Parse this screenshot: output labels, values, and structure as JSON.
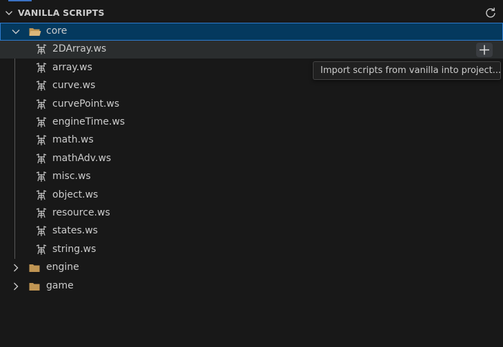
{
  "section": {
    "title": "VANILLA SCRIPTS",
    "collapse_icon": "chevron-down-icon",
    "refresh_icon": "refresh-icon"
  },
  "tree": {
    "core": {
      "label": "core",
      "expanded": true,
      "files": [
        {
          "label": "2DArray.ws"
        },
        {
          "label": "array.ws"
        },
        {
          "label": "curve.ws"
        },
        {
          "label": "curvePoint.ws"
        },
        {
          "label": "engineTime.ws"
        },
        {
          "label": "math.ws"
        },
        {
          "label": "mathAdv.ws"
        },
        {
          "label": "misc.ws"
        },
        {
          "label": "object.ws"
        },
        {
          "label": "resource.ws"
        },
        {
          "label": "states.ws"
        },
        {
          "label": "string.ws"
        }
      ]
    },
    "engine": {
      "label": "engine",
      "expanded": false
    },
    "game": {
      "label": "game",
      "expanded": false
    }
  },
  "hover_action": {
    "icon": "plus-icon",
    "tooltip": "Import scripts from vanilla into project..."
  },
  "colors": {
    "background": "#181818",
    "selection": "#04395e",
    "selection_border": "#2f7ccf",
    "hover": "#2a2d2e",
    "folder": "#c09553",
    "text": "#cccccc"
  }
}
